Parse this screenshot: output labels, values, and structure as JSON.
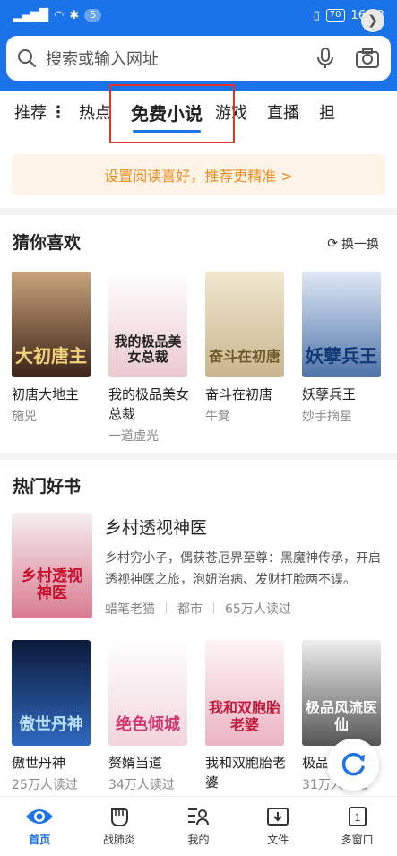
{
  "status_bar": {
    "badge": "5",
    "battery": "70",
    "time": "16:42"
  },
  "search": {
    "placeholder": "搜索或输入网址"
  },
  "tabs": [
    {
      "label": "推荐",
      "active": false
    },
    {
      "label": "热点",
      "active": false
    },
    {
      "label": "免费小说",
      "active": true
    },
    {
      "label": "游戏",
      "active": false
    },
    {
      "label": "直播",
      "active": false
    },
    {
      "label": "担",
      "active": false
    }
  ],
  "banner": {
    "text": "设置阅读喜好，推荐更精准 >"
  },
  "guess": {
    "title": "猜你喜欢",
    "refresh_label": "换一换",
    "books": [
      {
        "title": "初唐大地主",
        "author": "施兕",
        "cover_text": "大初唐主",
        "cover_color": "#5a3a2a"
      },
      {
        "title": "我的极品美女总裁",
        "author": "一道虚光",
        "cover_text": "我的极品美女总裁",
        "cover_color": "#f2e6e6"
      },
      {
        "title": "奋斗在初唐",
        "author": "牛凳",
        "cover_text": "奋斗在初唐",
        "cover_color": "#e8dcc0"
      },
      {
        "title": "妖孽兵王",
        "author": "妙手摘星",
        "cover_text": "妖孽兵王",
        "cover_color": "#8fb0d8"
      }
    ]
  },
  "hot": {
    "title": "热门好书",
    "featured": {
      "title": "乡村透视神医",
      "desc": "乡村穷小子，偶获苍厄界至尊：黑魔神传承，开启透视神医之旅，泡妞治病、发财打脸两不误。",
      "author": "蜡笔老猫",
      "category": "都市",
      "readers": "65万人读过",
      "cover_text": "乡村透视神医"
    },
    "books": [
      {
        "title": "傲世丹神",
        "readers": "25万人读过",
        "cover_text": "傲世丹神",
        "cover_color": "#1c3a6e"
      },
      {
        "title": "赘婿当道",
        "readers": "34万人读过",
        "cover_text": "绝色倾城",
        "cover_color": "#f3e2e6"
      },
      {
        "title": "我和双胞胎老婆",
        "readers": "",
        "cover_text": "我和双胞胎老婆",
        "cover_color": "#f6e6ea"
      },
      {
        "title": "极品",
        "readers": "31万人读过",
        "cover_text": "极品风流医仙",
        "cover_color": "#d9d9d9"
      }
    ]
  },
  "bottom_nav": [
    {
      "label": "首页",
      "icon": "eye-icon",
      "active": true
    },
    {
      "label": "战肺炎",
      "icon": "fist-icon",
      "active": false
    },
    {
      "label": "我的",
      "icon": "profile-icon",
      "active": false
    },
    {
      "label": "文件",
      "icon": "download-icon",
      "active": false
    },
    {
      "label": "多窗口",
      "icon": "windows-icon",
      "active": false
    }
  ],
  "colors": {
    "brand": "#1a73e8",
    "banner_text": "#f08a1c",
    "highlight_box": "#e0342a"
  }
}
